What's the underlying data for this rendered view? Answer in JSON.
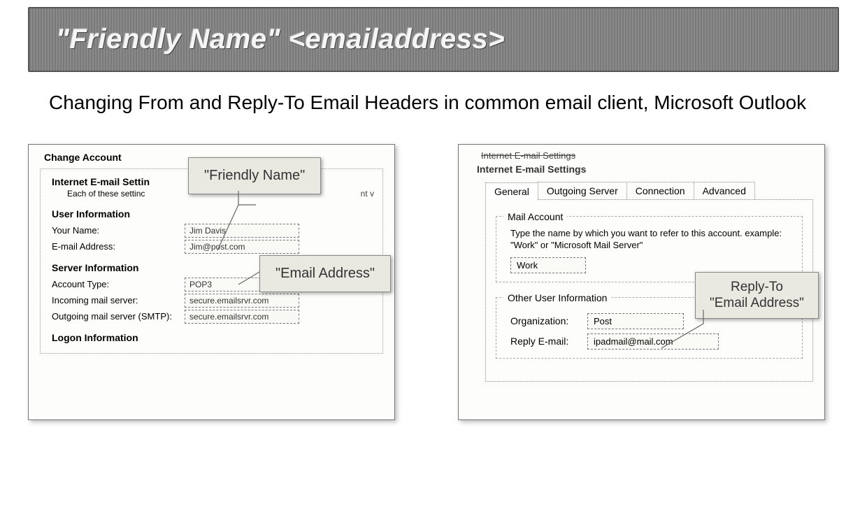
{
  "banner": {
    "title": "\"Friendly Name\" <emailaddress>"
  },
  "subtitle": "Changing From and Reply-To Email Headers in common email client, Microsoft Outlook",
  "left": {
    "dialog_title": "Change Account",
    "header_line1": "Internet E-mail Settin",
    "header_line2": "Each of these settinc",
    "header_trail": "nt v",
    "sections": {
      "user_info": "User Information",
      "server_info": "Server Information",
      "logon_info": "Logon Information"
    },
    "rows": {
      "your_name_label": "Your Name:",
      "your_name_value": "Jim Davis",
      "email_label": "E-mail Address:",
      "email_value": "Jim@post.com",
      "account_type_label": "Account Type:",
      "account_type_value": "POP3",
      "incoming_label": "Incoming mail server:",
      "incoming_value": "secure.emailsrvr.com",
      "outgoing_label": "Outgoing mail server (SMTP):",
      "outgoing_value": "secure.emailsrvr.com"
    },
    "callouts": {
      "friendly": "\"Friendly Name\"",
      "email": "\"Email Address\""
    }
  },
  "right": {
    "struck_title": "Internet E-mail Settings",
    "dialog_title": "Internet E-mail Settings",
    "tabs": [
      "General",
      "Outgoing Server",
      "Connection",
      "Advanced"
    ],
    "mail_account": {
      "legend": "Mail Account",
      "hint": "Type the name by which you want to refer to this account. example: \"Work\" or \"Microsoft Mail Server\"",
      "value": "Work"
    },
    "other": {
      "legend": "Other User Information",
      "org_label": "Organization:",
      "org_value": "Post",
      "reply_label": "Reply E-mail:",
      "reply_value": "ipadmail@mail.com"
    },
    "callout": {
      "line1": "Reply-To",
      "line2": "\"Email Address\""
    }
  }
}
